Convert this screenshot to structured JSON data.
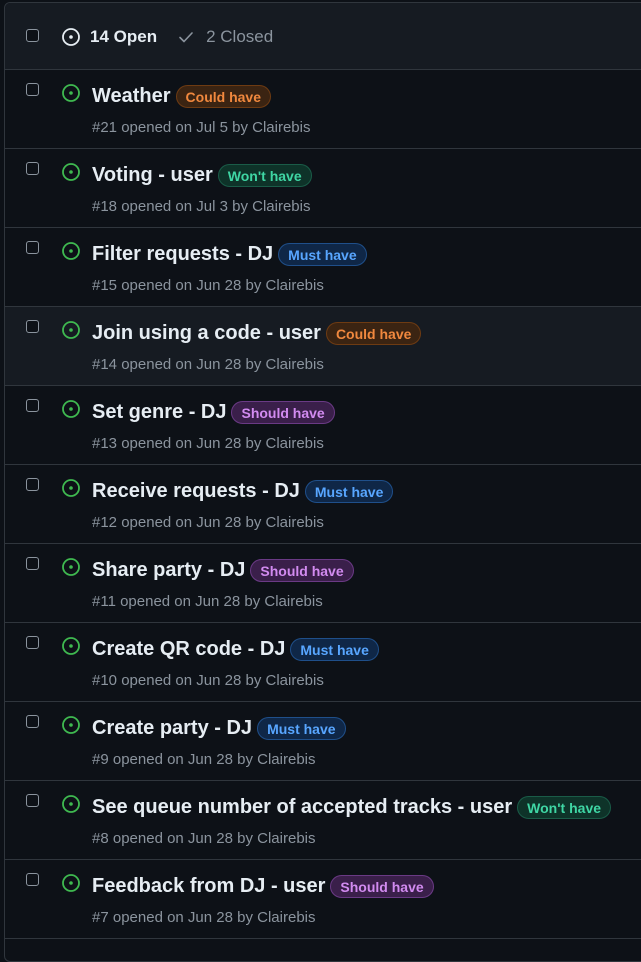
{
  "header": {
    "open_label": "14 Open",
    "closed_label": "2 Closed"
  },
  "colors": {
    "open_icon": "#3fb950",
    "could_have": "#f0883e",
    "wont_have": "#3fd6a4",
    "must_have": "#58a6ff",
    "should_have": "#d28bf0"
  },
  "issues": [
    {
      "title": "Weather",
      "label": "Could have",
      "meta": "#21 opened on Jul 5 by Clairebis"
    },
    {
      "title": "Voting - user",
      "label": "Won't have",
      "meta": "#18 opened on Jul 3 by Clairebis"
    },
    {
      "title": "Filter requests - DJ",
      "label": "Must have",
      "meta": "#15 opened on Jun 28 by Clairebis"
    },
    {
      "title": "Join using a code - user",
      "label": "Could have",
      "meta": "#14 opened on Jun 28 by Clairebis"
    },
    {
      "title": "Set genre - DJ",
      "label": "Should have",
      "meta": "#13 opened on Jun 28 by Clairebis"
    },
    {
      "title": "Receive requests - DJ",
      "label": "Must have",
      "meta": "#12 opened on Jun 28 by Clairebis"
    },
    {
      "title": "Share party - DJ",
      "label": "Should have",
      "meta": "#11 opened on Jun 28 by Clairebis"
    },
    {
      "title": "Create QR code - DJ",
      "label": "Must have",
      "meta": "#10 opened on Jun 28 by Clairebis"
    },
    {
      "title": "Create party - DJ",
      "label": "Must have",
      "meta": "#9 opened on Jun 28 by Clairebis"
    },
    {
      "title": "See queue number of accepted tracks - user",
      "label": "Won't have",
      "meta": "#8 opened on Jun 28 by Clairebis"
    },
    {
      "title": "Feedback from DJ - user",
      "label": "Should have",
      "meta": "#7 opened on Jun 28 by Clairebis"
    }
  ]
}
